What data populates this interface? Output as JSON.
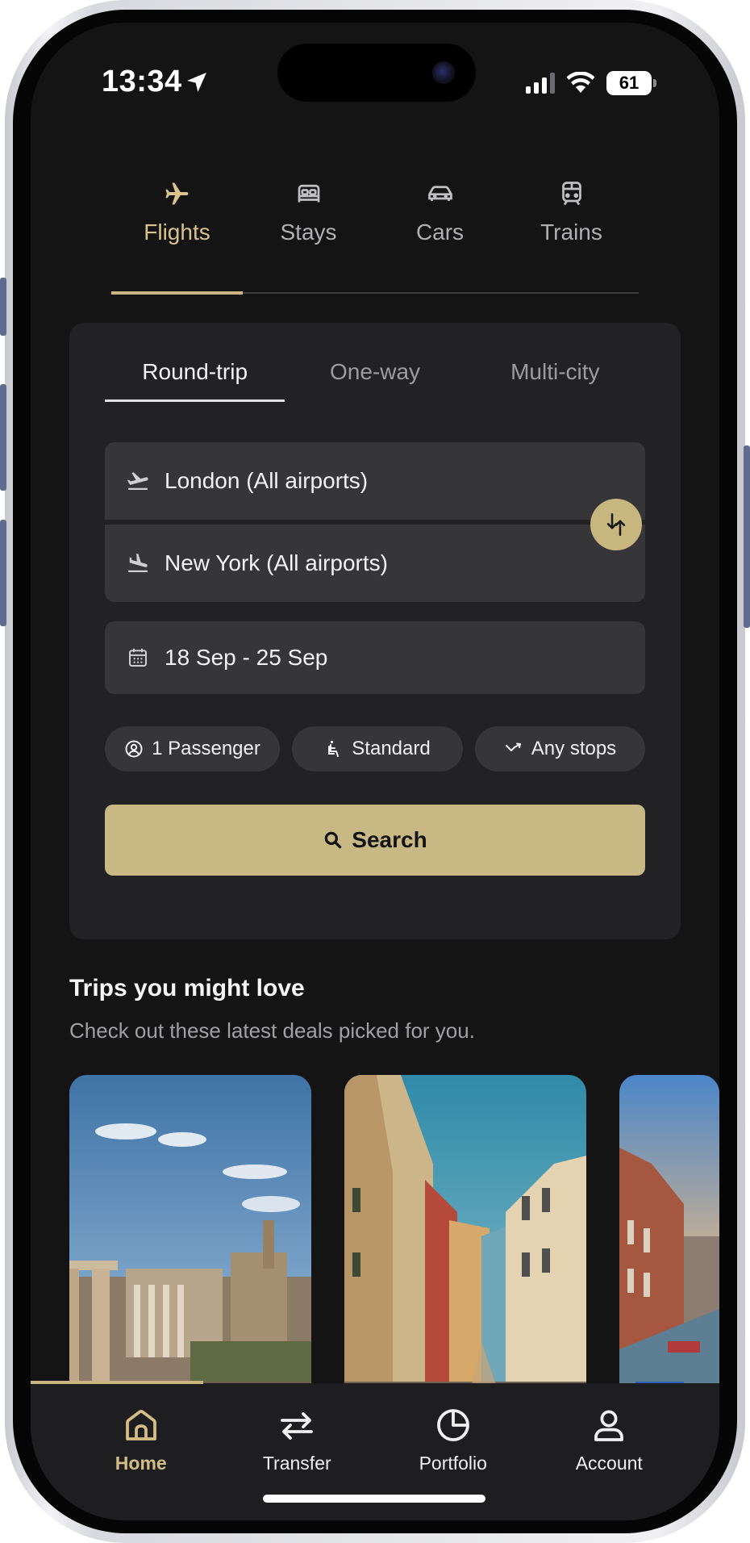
{
  "status_bar": {
    "time": "13:34",
    "battery": "61"
  },
  "categories": [
    {
      "label": "Flights",
      "icon": "airplane-icon",
      "active": true
    },
    {
      "label": "Stays",
      "icon": "bed-icon",
      "active": false
    },
    {
      "label": "Cars",
      "icon": "car-icon",
      "active": false
    },
    {
      "label": "Trains",
      "icon": "train-icon",
      "active": false
    }
  ],
  "trip_types": [
    {
      "label": "Round-trip",
      "active": true
    },
    {
      "label": "One-way",
      "active": false
    },
    {
      "label": "Multi-city",
      "active": false
    }
  ],
  "search": {
    "from": "London (All airports)",
    "to": "New York (All airports)",
    "dates": "18 Sep - 25 Sep",
    "passengers": "1 Passenger",
    "cabin": "Standard",
    "stops": "Any stops",
    "button": "Search"
  },
  "trips": {
    "title": "Trips you might love",
    "subtitle": "Check out these latest deals picked for you."
  },
  "nav": [
    {
      "label": "Home",
      "icon": "home-icon",
      "active": true
    },
    {
      "label": "Transfer",
      "icon": "transfer-icon",
      "active": false
    },
    {
      "label": "Portfolio",
      "icon": "pie-chart-icon",
      "active": false
    },
    {
      "label": "Account",
      "icon": "person-icon",
      "active": false
    }
  ],
  "colors": {
    "accent": "#c8b67f",
    "background": "#141415",
    "card": "#222224",
    "field": "#363639"
  }
}
